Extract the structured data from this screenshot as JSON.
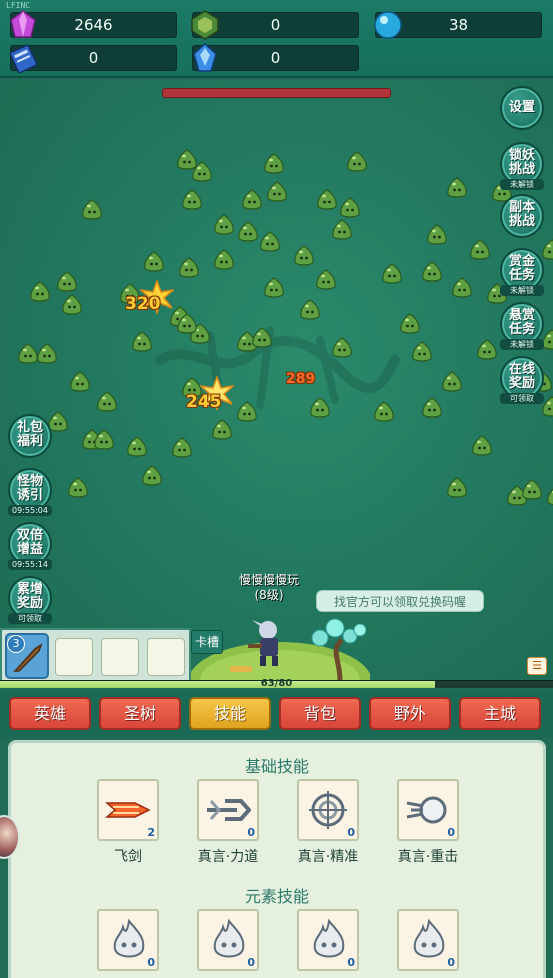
{
  "top_tag": "LFINC",
  "resources": [
    {
      "name": "gem",
      "icon": "purple-gem-icon",
      "value": "2646"
    },
    {
      "name": "token",
      "icon": "green-token-icon",
      "value": "0"
    },
    {
      "name": "orb",
      "icon": "blue-orb-icon",
      "value": "38"
    },
    {
      "name": "book",
      "icon": "blue-book-icon",
      "value": "0"
    },
    {
      "name": "crystal",
      "icon": "blue-crystal-icon",
      "value": "0"
    }
  ],
  "damage_numbers": [
    "320",
    "245",
    "289"
  ],
  "right_buttons": [
    {
      "label": "设置",
      "sub": ""
    },
    {
      "label": "锁妖挑战",
      "sub": "未解锁"
    },
    {
      "label": "副本挑战",
      "sub": ""
    },
    {
      "label": "赏金任务",
      "sub": "未解锁"
    },
    {
      "label": "悬赏任务",
      "sub": "未解锁"
    },
    {
      "label": "在线奖励",
      "sub": "可领取"
    }
  ],
  "left_buttons": [
    {
      "label": "礼包福利",
      "sub": ""
    },
    {
      "label": "怪物诱引",
      "sub": "09:55:04"
    },
    {
      "label": "双倍增益",
      "sub": "09:55:14"
    },
    {
      "label": "累增奖励",
      "sub": "可领取"
    }
  ],
  "hero": {
    "name": "慢慢慢慢玩",
    "level": "(8级)"
  },
  "hint_text": "找官方可以领取兑换码喔",
  "card_badge": "3",
  "card_slot_label": "卡槽",
  "xp": {
    "text": "63/80",
    "current": 63,
    "max": 80
  },
  "tabs": [
    {
      "label": "英雄",
      "active": false
    },
    {
      "label": "圣树",
      "active": false
    },
    {
      "label": "技能",
      "active": true
    },
    {
      "label": "背包",
      "active": false
    },
    {
      "label": "野外",
      "active": false
    },
    {
      "label": "主城",
      "active": false
    }
  ],
  "skills": {
    "basic_title": "基础技能",
    "basic": [
      {
        "name": "飞剑",
        "level": "2",
        "icon": "flying-sword-icon"
      },
      {
        "name": "真言·力道",
        "level": "0",
        "icon": "trident-icon"
      },
      {
        "name": "真言·精准",
        "level": "0",
        "icon": "crosshair-icon"
      },
      {
        "name": "真言·重击",
        "level": "0",
        "icon": "heavy-strike-icon"
      }
    ],
    "element_title": "元素技能",
    "element": [
      {
        "level": "0",
        "icon": "flame-spirit-icon"
      },
      {
        "level": "0",
        "icon": "flame-spirit-icon"
      },
      {
        "level": "0",
        "icon": "flame-spirit-icon"
      },
      {
        "level": "0",
        "icon": "flame-spirit-icon"
      }
    ]
  },
  "colors": {
    "tab_red": "#e45a45",
    "tab_active": "#f0b632",
    "field_green": "#237a60",
    "slime_green": "#5fa142"
  }
}
